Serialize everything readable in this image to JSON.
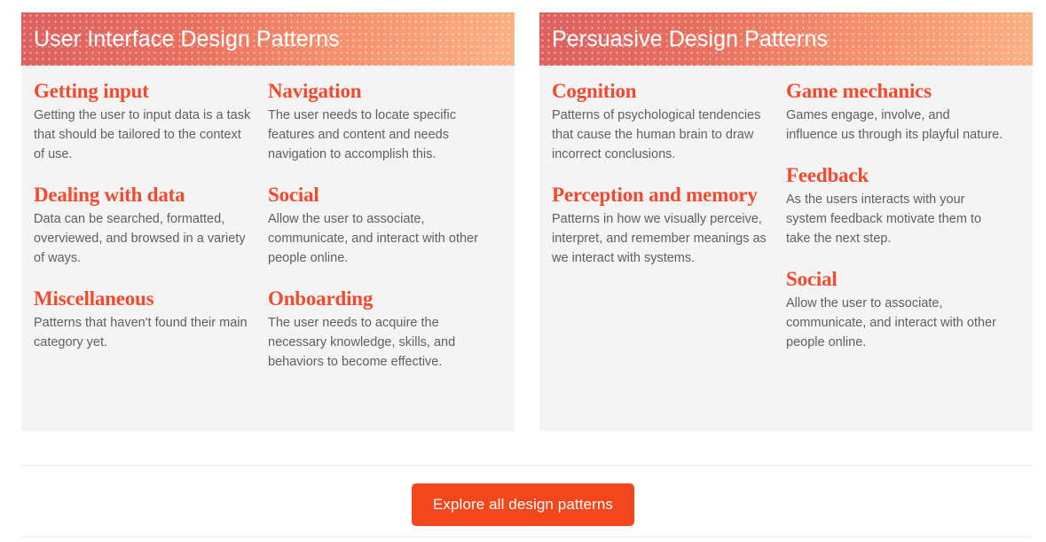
{
  "colors": {
    "accent_heading": "#f4492d",
    "button_bg": "#f4461c",
    "card_bg": "#f4f4f4",
    "header_gradient_start": "#dc6060",
    "header_gradient_end": "#fbb184",
    "body_text": "#5f5f5f",
    "divider": "#ececec"
  },
  "cards": [
    {
      "title": "User Interface Design Patterns",
      "columns": [
        {
          "entries": [
            {
              "title": "Getting input",
              "desc": "Getting the user to input data is a task that should be tailored to the context of use."
            },
            {
              "title": "Dealing with data",
              "desc": "Data can be searched, formatted, overviewed, and browsed in a variety of ways."
            },
            {
              "title": "Miscellaneous",
              "desc": "Patterns that haven't found their main category yet."
            }
          ]
        },
        {
          "entries": [
            {
              "title": "Navigation",
              "desc": "The user needs to locate specific features and content and needs navigation to accomplish this."
            },
            {
              "title": "Social",
              "desc": "Allow the user to associate, communicate, and interact with other people online."
            },
            {
              "title": "Onboarding",
              "desc": "The user needs to acquire the necessary knowledge, skills, and behaviors to become effective."
            }
          ]
        }
      ]
    },
    {
      "title": "Persuasive Design Patterns",
      "columns": [
        {
          "entries": [
            {
              "title": "Cognition",
              "desc": "Patterns of psychological tendencies that cause the human brain to draw incorrect conclusions."
            },
            {
              "title": "Perception and memory",
              "desc": "Patterns in how we visually perceive, interpret, and remember meanings as we interact with systems."
            }
          ]
        },
        {
          "entries": [
            {
              "title": "Game mechanics",
              "desc": "Games engage, involve, and influence us through its playful nature."
            },
            {
              "title": "Feedback",
              "desc": "As the users interacts with your system feedback motivate them to take the next step."
            },
            {
              "title": "Social",
              "desc": "Allow the user to associate, communicate, and interact with other people online."
            }
          ]
        }
      ]
    }
  ],
  "cta": {
    "label": "Explore all design patterns"
  }
}
